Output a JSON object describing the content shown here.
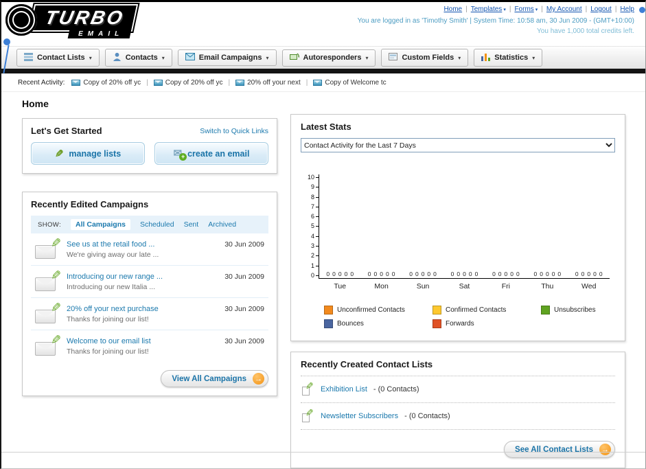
{
  "header": {
    "logo": {
      "line1": "TURBO",
      "line2": "EMAIL"
    },
    "nav_links": [
      {
        "label": "Home",
        "caret": false
      },
      {
        "label": "Templates",
        "caret": true
      },
      {
        "label": "Forms",
        "caret": true
      },
      {
        "label": "My Account",
        "caret": false
      },
      {
        "label": "Logout",
        "caret": false
      },
      {
        "label": "Help",
        "caret": false
      }
    ],
    "status_line1": "You are logged in as 'Timothy Smith' | System Time: 10:58 am, 30 Jun 2009 - (GMT+10:00)",
    "status_line2": "You have 1,000 total credits left."
  },
  "nav_tabs": [
    {
      "label": "Contact Lists",
      "icon": "contact-lists-icon"
    },
    {
      "label": "Contacts",
      "icon": "contacts-icon"
    },
    {
      "label": "Email Campaigns",
      "icon": "email-campaigns-icon"
    },
    {
      "label": "Autoresponders",
      "icon": "autoresponders-icon"
    },
    {
      "label": "Custom Fields",
      "icon": "custom-fields-icon"
    },
    {
      "label": "Statistics",
      "icon": "statistics-icon"
    }
  ],
  "recent_activity": {
    "label": "Recent Activity:",
    "items": [
      "Copy of 20% off yc",
      "Copy of 20% off yc",
      "20% off your next",
      "Copy of Welcome tc"
    ]
  },
  "page_title": "Home",
  "get_started": {
    "title": "Let's Get Started",
    "switch_link": "Switch to Quick Links",
    "manage_label": "manage lists",
    "create_label": "create an email"
  },
  "campaigns": {
    "title": "Recently Edited Campaigns",
    "show_label": "SHOW:",
    "tabs": [
      "All Campaigns",
      "Scheduled",
      "Sent",
      "Archived"
    ],
    "selected_tab": "All Campaigns",
    "items": [
      {
        "title": "See us at the retail food ...",
        "subtitle": "We're giving away our late ...",
        "date": "30 Jun 2009"
      },
      {
        "title": "Introducing our new range ...",
        "subtitle": "Introducing our new Italia ...",
        "date": "30 Jun 2009"
      },
      {
        "title": "20% off your next purchase",
        "subtitle": "Thanks for joining our list!",
        "date": "30 Jun 2009"
      },
      {
        "title": "Welcome to our email list",
        "subtitle": "Thanks for joining our list!",
        "date": "30 Jun 2009"
      }
    ],
    "view_all_label": "View All Campaigns"
  },
  "stats": {
    "title": "Latest Stats",
    "period_options": [
      "Contact Activity for the Last 7 Days"
    ]
  },
  "chart_data": {
    "type": "bar",
    "title": "Contact Activity for the Last 7 Days",
    "categories": [
      "Tue",
      "Mon",
      "Sun",
      "Sat",
      "Fri",
      "Thu",
      "Wed"
    ],
    "series": [
      {
        "name": "Unconfirmed Contacts",
        "color": "#f28a1e",
        "values": [
          0,
          0,
          0,
          0,
          0,
          0,
          0
        ]
      },
      {
        "name": "Confirmed Contacts",
        "color": "#fdc82f",
        "values": [
          0,
          0,
          0,
          0,
          0,
          0,
          0
        ]
      },
      {
        "name": "Unsubscribes",
        "color": "#5fa321",
        "values": [
          0,
          0,
          0,
          0,
          0,
          0,
          0
        ]
      },
      {
        "name": "Bounces",
        "color": "#4a66a0",
        "values": [
          0,
          0,
          0,
          0,
          0,
          0,
          0
        ]
      },
      {
        "name": "Forwards",
        "color": "#e05226",
        "values": [
          0,
          0,
          0,
          0,
          0,
          0,
          0
        ]
      }
    ],
    "xlabel": "",
    "ylabel": "",
    "ylim": [
      0,
      10
    ],
    "yticks": [
      0,
      1,
      2,
      3,
      4,
      5,
      6,
      7,
      8,
      9,
      10
    ],
    "grid": false,
    "legend_position": "bottom",
    "show_zero_value_labels": true
  },
  "contact_lists": {
    "title": "Recently Created Contact Lists",
    "items": [
      {
        "name": "Exhibition List",
        "count": "- (0 Contacts)"
      },
      {
        "name": "Newsletter Subscribers",
        "count": "- (0 Contacts)"
      }
    ],
    "see_all_label": "See All Contact Lists"
  },
  "colors": {
    "link": "#1b79ad",
    "accent_orange": "#f29213",
    "status_text": "#4c9cc2",
    "nav_black_bar": "#141414"
  }
}
